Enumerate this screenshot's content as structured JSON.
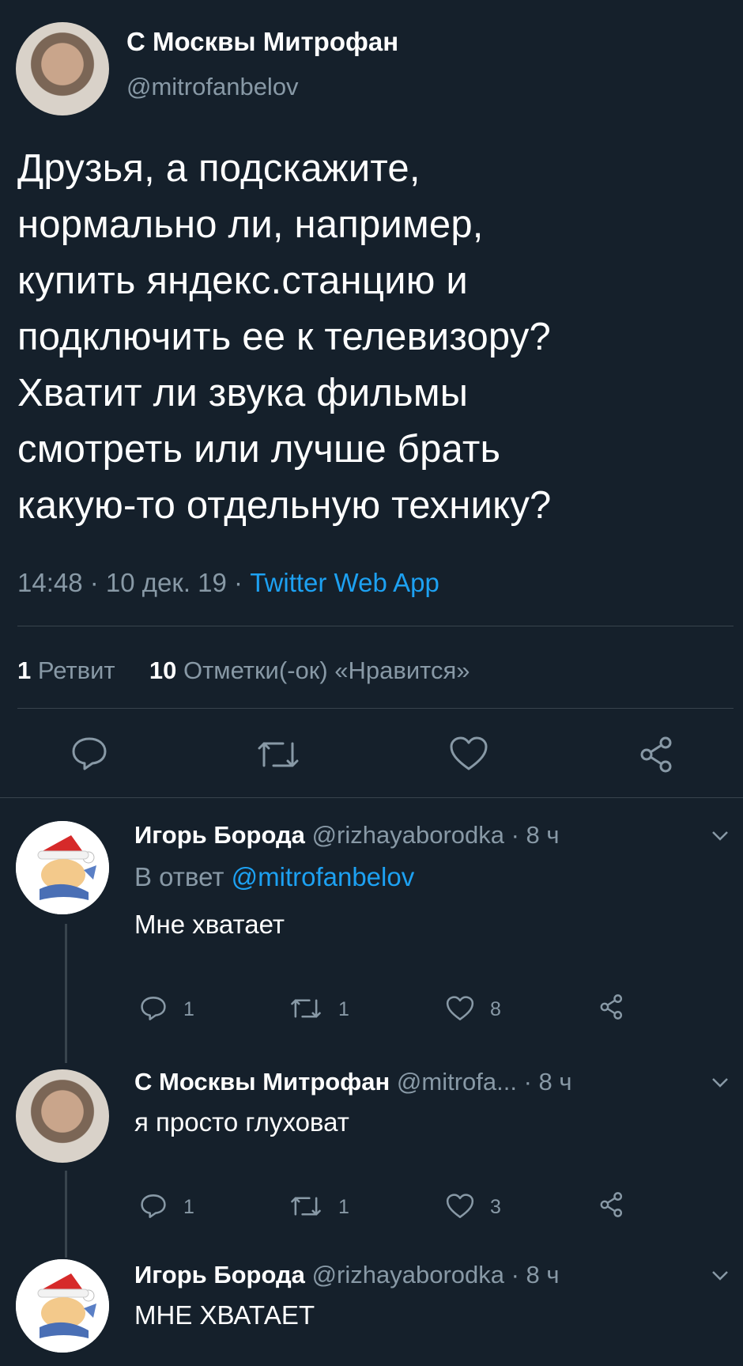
{
  "main_tweet": {
    "name": "С Москвы Митрофан",
    "handle": "@mitrofanbelov",
    "lines": [
      "Друзья, а подскажите,",
      "нормально ли, например,",
      "купить яндекс.станцию и",
      "подключить ее к телевизору?",
      "Хватит ли звука фильмы",
      "смотреть или лучше брать",
      "какую-то отдельную технику?"
    ],
    "meta_time": "14:48 · 10 дек. 19 · ",
    "meta_source": "Twitter Web App",
    "retweets_count": "1",
    "retweets_label": "Ретвит",
    "likes_count": "10",
    "likes_label": "Отметки(-ок) «Нравится»"
  },
  "replies": [
    {
      "name": "Игорь Борода",
      "handle_time": "@rizhayaborodka · 8 ч",
      "reply_prefix": "В ответ ",
      "reply_to": "@mitrofanbelov",
      "text": "Мне хватает",
      "reply_count": "1",
      "retweet_count": "1",
      "like_count": "8"
    },
    {
      "name": "С Москвы Митрофан",
      "handle_time": "@mitrofa... · 8 ч",
      "text": "я просто глуховат",
      "reply_count": "1",
      "retweet_count": "1",
      "like_count": "3"
    },
    {
      "name": "Игорь Борода",
      "handle_time": "@rizhayaborodka · 8 ч",
      "text": "МНЕ ХВАТАЕТ"
    }
  ],
  "icons": [
    "reply-icon",
    "retweet-icon",
    "like-icon",
    "share-icon",
    "chevron-down-icon"
  ],
  "colors": {
    "background": "#15202b",
    "text": "#ffffff",
    "muted": "#8899a6",
    "link": "#1da1f2",
    "divider": "#38444d"
  }
}
